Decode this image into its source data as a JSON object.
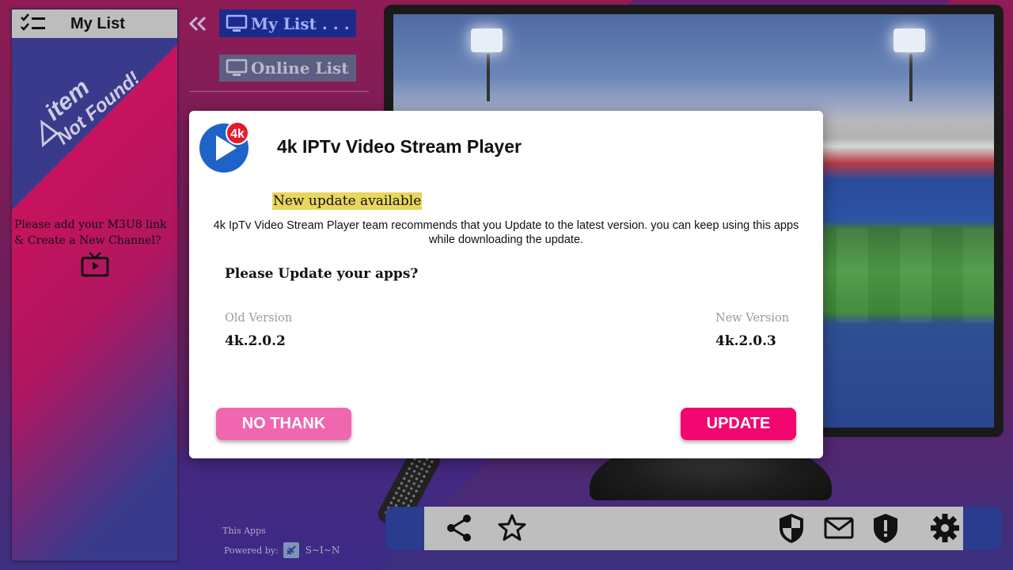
{
  "left_panel": {
    "title": "My List",
    "watermark_line1": "item",
    "watermark_line2": "Not Found!",
    "empty_message": "Please add your M3U8 link & Create a New Channel?"
  },
  "nav": {
    "my_list": "My List . . .",
    "online_list": "Online List"
  },
  "footer": {
    "line1": "This Apps",
    "line2": "Powered by:",
    "brand": "S~I~N"
  },
  "dialog": {
    "app_name": "4k IPTv Video Stream Player",
    "logo_badge": "4k",
    "update_tag": "New update available",
    "description": "4k IpTv Video Stream Player team recommends that you Update to the latest version. you can keep using this apps while downloading the update.",
    "question": "Please Update your apps?",
    "old_version_label": "Old Version",
    "old_version_value": "4k.2.0.2",
    "new_version_label": "New Version",
    "new_version_value": "4k.2.0.3",
    "no_button": "NO THANK",
    "update_button": "UPDATE"
  },
  "colors": {
    "update_button": "#f2066f",
    "no_button": "#f067b0",
    "nav_active": "#1c2a8c",
    "highlight": "#e8d65f"
  },
  "toolbar_icons": [
    "share-icon",
    "star-icon",
    "shield-icon",
    "mail-icon",
    "alert-shield-icon",
    "gear-icon"
  ]
}
